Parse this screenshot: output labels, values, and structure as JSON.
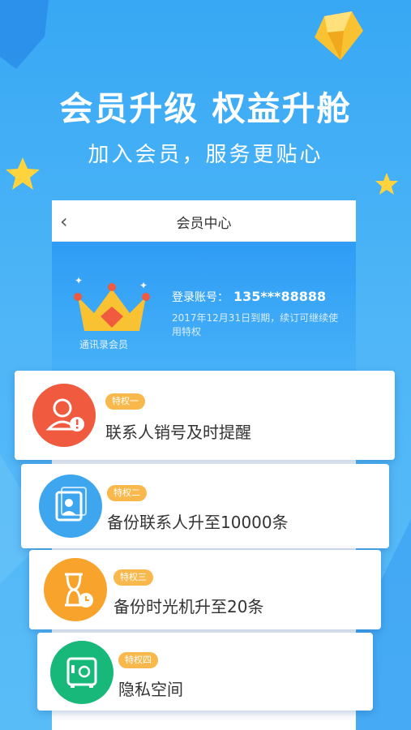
{
  "hero": {
    "title": "会员升级 权益升舱",
    "subtitle": "加入会员，服务更贴心"
  },
  "screen": {
    "nav_title": "会员中心",
    "member_label": "通讯录会员",
    "account_label": "登录账号：",
    "account_value": "135***88888",
    "expiry_note": "2017年12月31日到期，续订可继续使用特权"
  },
  "privileges": [
    {
      "badge": "特权一",
      "text": "联系人销号及时提醒",
      "icon": "person-alert-icon",
      "color": "#f05a3f"
    },
    {
      "badge": "特权二",
      "text": "备份联系人升至10000条",
      "icon": "contact-card-icon",
      "color": "#3ea6ef"
    },
    {
      "badge": "特权三",
      "text": "备份时光机升至20条",
      "icon": "hourglass-clock-icon",
      "color": "#f7a32c"
    },
    {
      "badge": "特权四",
      "text": "隐私空间",
      "icon": "safe-icon",
      "color": "#18b77a"
    }
  ]
}
